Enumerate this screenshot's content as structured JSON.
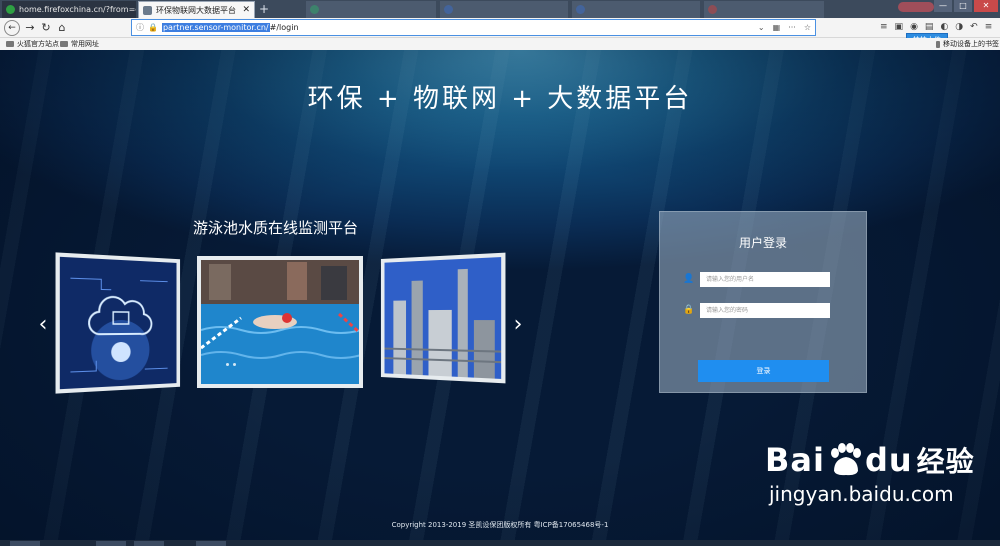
{
  "tabs": [
    {
      "title": "home.firefoxchina.cn/?from=ext",
      "state": "inactive",
      "favicon_color": "#2ea043"
    },
    {
      "title": "环保物联网大数据平台",
      "state": "active",
      "favicon_color": "#6a7a8c"
    }
  ],
  "ghost_tabs": [
    "",
    "",
    "",
    "",
    ""
  ],
  "close_glyph": "✕",
  "newtab_glyph": "+",
  "window_buttons": [
    "—",
    "□",
    "✕"
  ],
  "nav": {
    "back": "←",
    "forward": "→",
    "reload": "↻",
    "home": "⌂"
  },
  "url": {
    "info": "ⓘ",
    "lock": "🔒",
    "host": "partner.sensor-monitor.cn/",
    "path": "#/login",
    "dropdown": "⌄",
    "qr": "▦",
    "more": "···",
    "star": "☆"
  },
  "toolbar_icons": [
    "≡",
    "▣",
    "◉",
    "▤",
    "◐",
    "◑",
    "↶",
    "≡"
  ],
  "tooltip": "拍拍上传",
  "bookmarks": [
    {
      "label": "火狐官方站点"
    },
    {
      "label": "常用网址"
    },
    {
      "label": "移动设备上的书签"
    }
  ],
  "page": {
    "title": "环保 + 物联网 + 大数据平台",
    "subtitle": "游泳池水质在线监测平台",
    "prev": "‹",
    "next": "›",
    "copyright": "Copyright 2013-2019 圣凯设保团版权所有 粤ICP备17065468号-1"
  },
  "login": {
    "title": "用户登录",
    "username_placeholder": "请输入您的用户名",
    "password_placeholder": "请输入您的密码",
    "user_icon": "👤",
    "lock_icon": "🔒",
    "button": "登录"
  },
  "watermark": {
    "left": "Bai",
    "right": "du",
    "cn": "经验",
    "sub": "jingyan.baidu.com"
  },
  "colors": {
    "accent": "#1f8ef0",
    "url_highlight": "#3d7ee0",
    "tooltip": "#2d8ce0"
  }
}
